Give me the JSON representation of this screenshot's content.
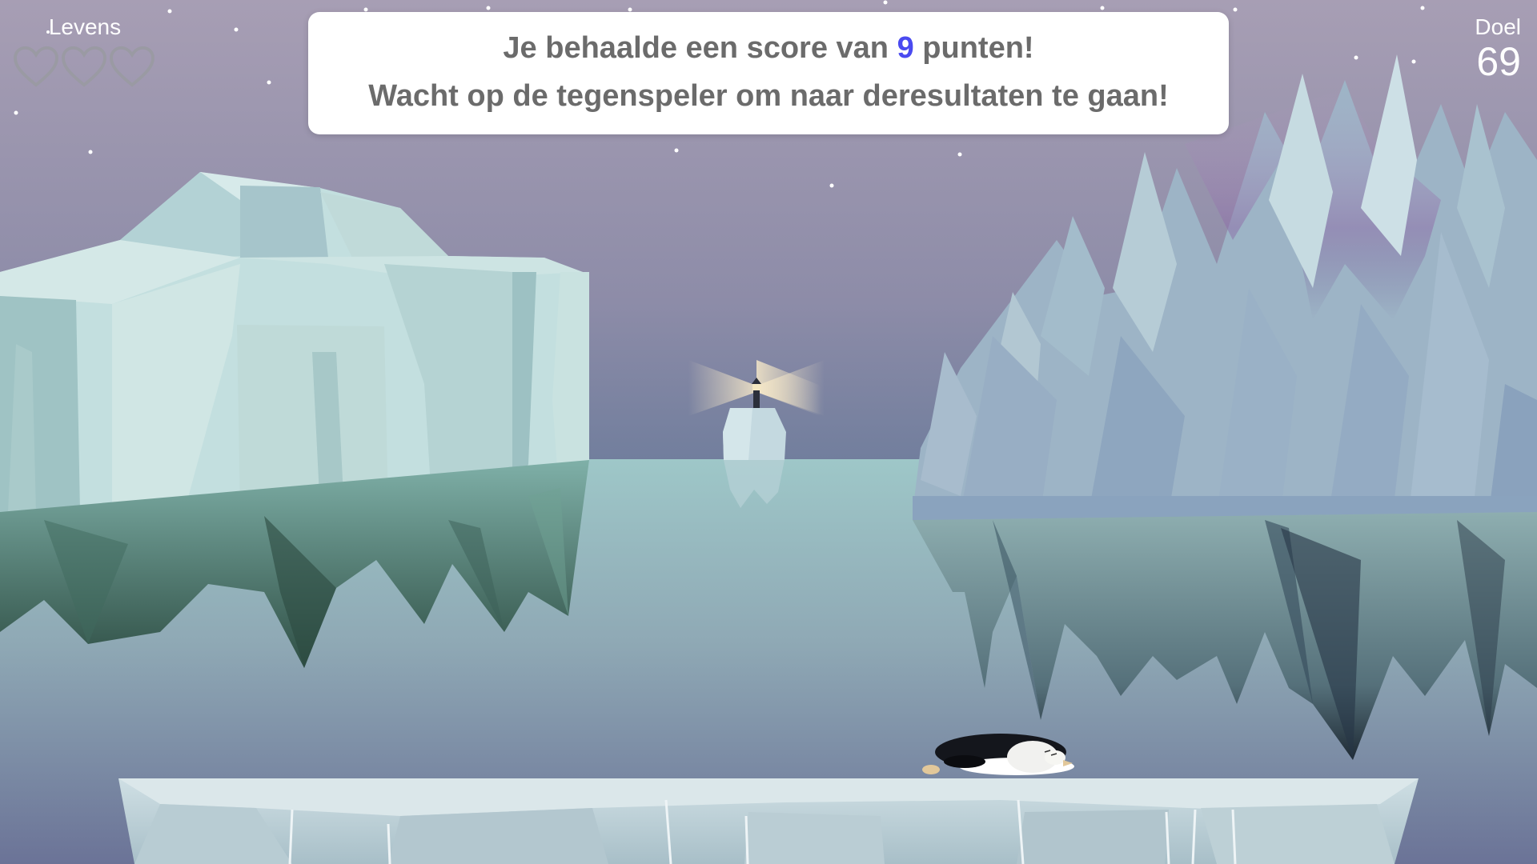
{
  "hud": {
    "lives_label": "Levens",
    "lives_remaining": 0,
    "lives_total": 3,
    "goal_label": "Doel",
    "goal_value": "69"
  },
  "result_message": {
    "line1_prefix": "Je behaalde een score van ",
    "score": "9",
    "line1_suffix": " punten!",
    "line2": "Wacht op de tegenspeler om naar deresultaten te gaan!"
  },
  "colors": {
    "score_accent": "#4a4af0",
    "heart_outline": "#9a9aa3",
    "sky_top": "#a69db3",
    "sky_bottom": "#6a7a9a",
    "water": "#97bfc4",
    "ice_light": "#c9e3e3"
  },
  "icons": {
    "life": "heart-outline-icon",
    "lighthouse": "lighthouse-icon",
    "player": "penguin-icon"
  }
}
